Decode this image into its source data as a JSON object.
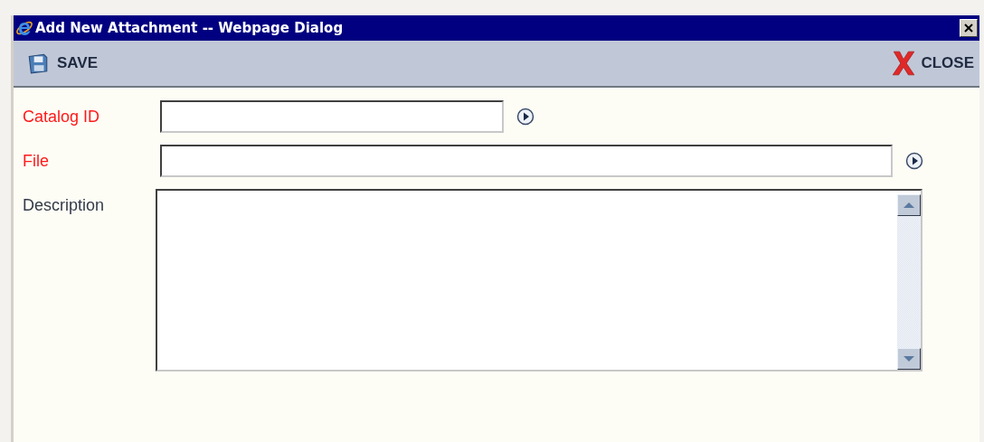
{
  "window": {
    "title": "Add New Attachment -- Webpage Dialog"
  },
  "toolbar": [
    {
      "kind": "save",
      "label": "SAVE"
    },
    {
      "kind": "close",
      "label": "CLOSE"
    }
  ],
  "fields": [
    {
      "kind": "short",
      "label": "Catalog ID",
      "required": true
    },
    {
      "kind": "long",
      "label": "File",
      "required": true
    },
    {
      "kind": "textarea",
      "label": "Description",
      "required": false
    }
  ]
}
